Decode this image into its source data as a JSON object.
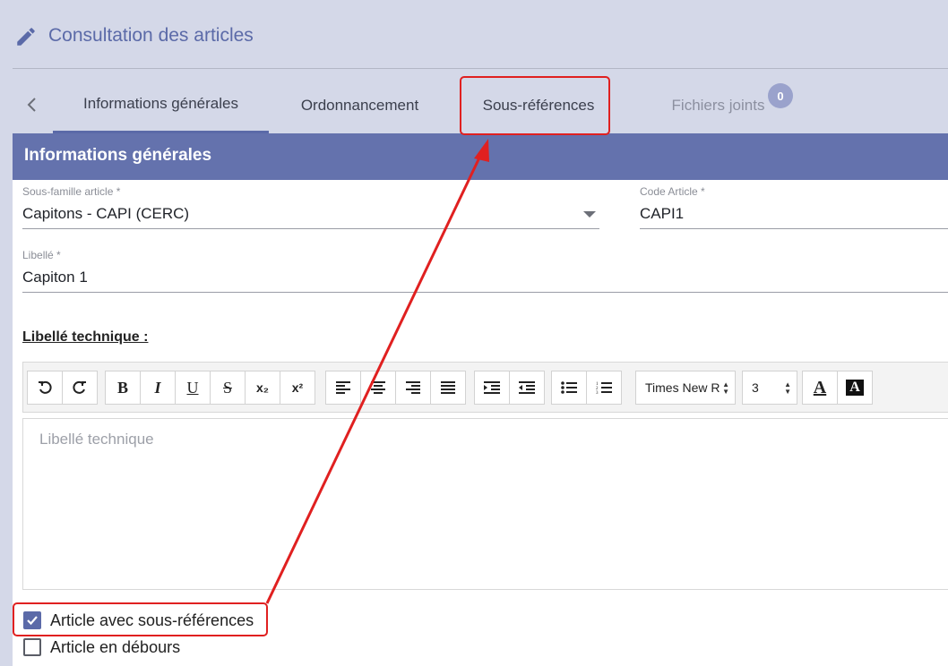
{
  "header": {
    "title": "Consultation des articles",
    "icon": "pencil-icon"
  },
  "tabs": [
    {
      "label": "Informations générales",
      "active": true
    },
    {
      "label": "Ordonnancement"
    },
    {
      "label": "Sous-références",
      "highlighted": true
    },
    {
      "label": "Fichiers joints",
      "badge": "0",
      "disabled": true
    }
  ],
  "card": {
    "title": "Informations générales"
  },
  "fields": {
    "sous_famille": {
      "label": "Sous-famille article *",
      "value": "Capitons - CAPI (CERC)"
    },
    "code_article": {
      "label": "Code Article *",
      "value": "CAPI1"
    },
    "libelle": {
      "label": "Libellé *",
      "value": "Capiton 1"
    }
  },
  "libelle_technique": {
    "title": "Libellé technique :",
    "placeholder": "Libellé technique",
    "font_select": "Times New R",
    "size_select": "3"
  },
  "toolbar_buttons": {
    "bold": "B",
    "italic": "I",
    "underline": "U",
    "strike": "S",
    "subscript": "x₂",
    "superscript": "x²",
    "font_color": "A",
    "bg_color": "A"
  },
  "checkboxes": [
    {
      "label": "Article avec sous-références",
      "checked": true,
      "highlighted": true
    },
    {
      "label": "Article en débours",
      "checked": false
    }
  ],
  "colors": {
    "accent": "#5b6aa8",
    "header_band": "#6472ad",
    "annotation": "#e02020"
  }
}
